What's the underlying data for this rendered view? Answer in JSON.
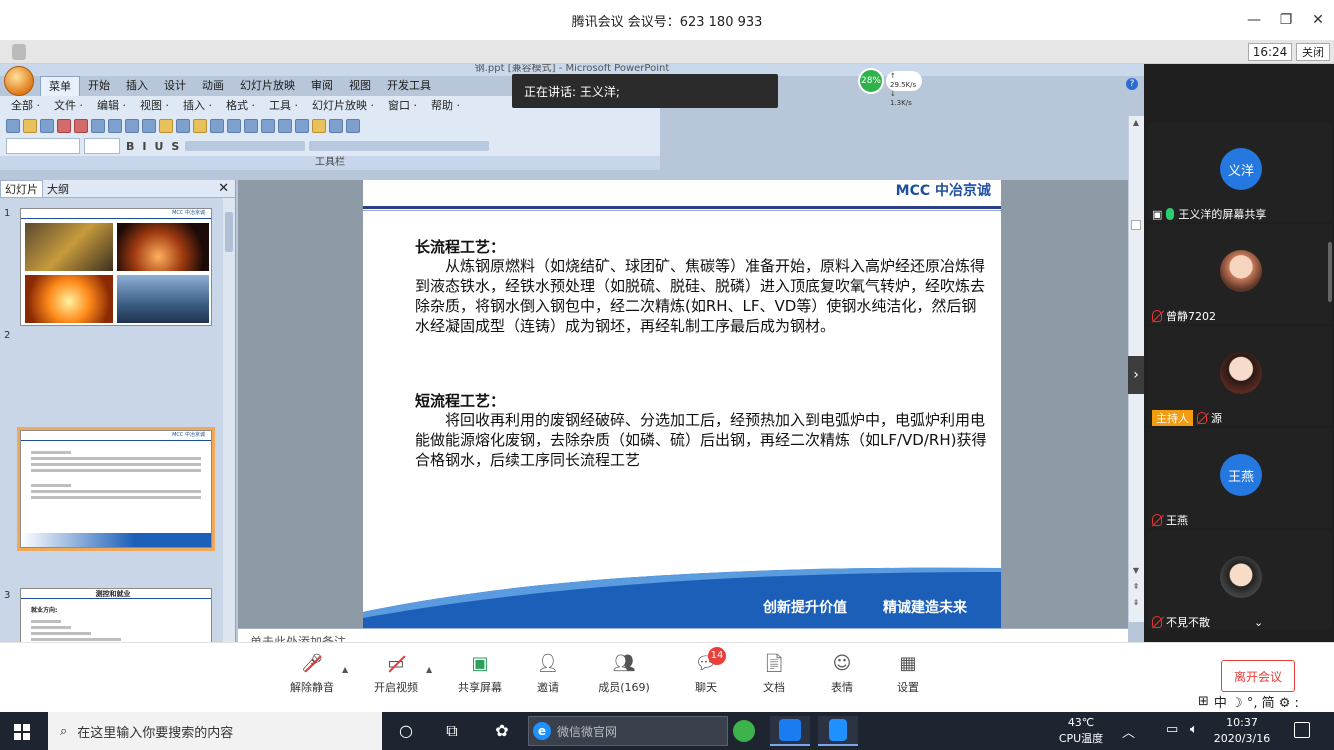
{
  "meeting": {
    "title": "腾讯会议 会议号：623 180 933",
    "clock": "16:24",
    "close_label": "关闭",
    "speaking": "正在讲话: 王义洋;",
    "net_percent": "28%",
    "net_up": "↑ 29.5K/s",
    "net_down": "↓ 1.3K/s"
  },
  "ppt": {
    "window_title": "钢.ppt [兼容模式] - Microsoft PowerPoint",
    "tabs": [
      "菜单",
      "开始",
      "插入",
      "设计",
      "动画",
      "幻灯片放映",
      "审阅",
      "视图",
      "开发工具"
    ],
    "menus": [
      "全部 ·",
      "文件 ·",
      "编辑 ·",
      "视图 ·",
      "插入 ·",
      "格式 ·",
      "工具 ·",
      "幻灯片放映 ·",
      "窗口 ·",
      "帮助 ·"
    ],
    "toolbar_label": "工具栏",
    "pane_tabs": [
      "幻灯片",
      "大纲"
    ],
    "slide_numbers": [
      "1",
      "2",
      "3"
    ],
    "thumb3_title": "测控和就业",
    "thumb3_heading": "就业方向:",
    "notes_placeholder": "单击此处添加备注"
  },
  "slide": {
    "logo": "MCC 中冶京诚",
    "long_title": "长流程工艺：",
    "long_text": "从炼钢原燃料（如烧结矿、球团矿、焦碳等）准备开始，原料入高炉经还原冶炼得到液态铁水，经铁水预处理（如脱硫、脱硅、脱磷）进入顶底复吹氧气转炉，经吹炼去除杂质，将钢水倒入钢包中，经二次精炼(如RH、LF、VD等）使钢水纯洁化，然后钢水经凝固成型（连铸）成为钢坯，再经轧制工序最后成为钢材。",
    "short_title": "短流程工艺：",
    "short_text": "将回收再利用的废钢经破碎、分选加工后，经预热加入到电弧炉中，电弧炉利用电能做能源熔化废钢，去除杂质（如磷、硫）后出钢，再经二次精炼（如LF/VD/RH)获得合格钢水，后续工序同长流程工艺",
    "slogan1": "创新提升价值",
    "slogan2": "精诚建造未来"
  },
  "participants": [
    {
      "name": "王义洋的屏幕共享",
      "avatar": "义洋",
      "mic": "on"
    },
    {
      "name": "曾静7202",
      "avatar": "",
      "mic": "off"
    },
    {
      "name": "源",
      "avatar": "",
      "mic": "off",
      "host": "主持人"
    },
    {
      "name": "王燕",
      "avatar": "王燕",
      "mic": "off"
    },
    {
      "name": "不見不散",
      "avatar": "",
      "mic": "off"
    }
  ],
  "controls": {
    "mute": "解除静音",
    "video": "开启视频",
    "share": "共享屏幕",
    "invite": "邀请",
    "members": "成员(169)",
    "chat": "聊天",
    "chat_badge": "14",
    "docs": "文档",
    "emoji": "表情",
    "settings": "设置",
    "leave": "离开会议"
  },
  "ime": "中 ☽ °, 简 ⚙ :",
  "taskbar": {
    "search_placeholder": "在这里输入你要搜索的内容",
    "browser_text": "微信微官网",
    "temp": "43℃",
    "temp_label": "CPU温度",
    "time": "10:37",
    "date": "2020/3/16"
  }
}
